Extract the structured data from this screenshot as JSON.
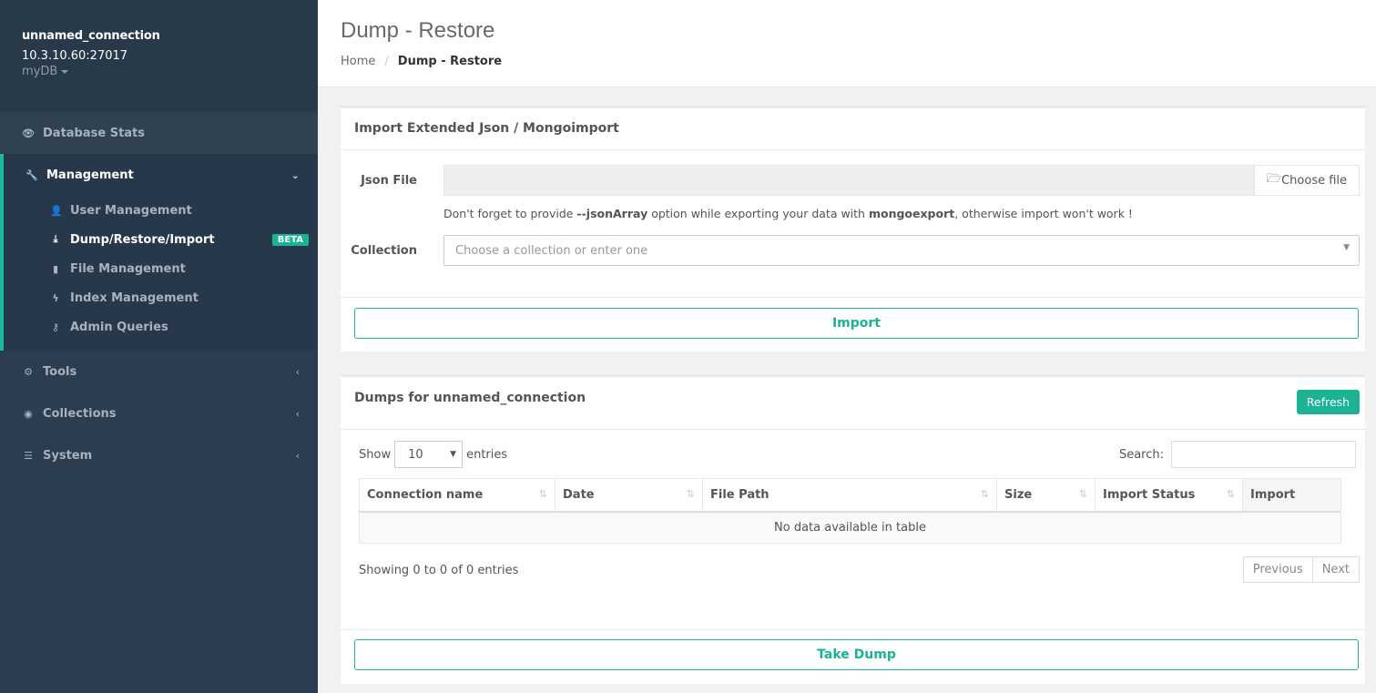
{
  "sidebar": {
    "connection": "unnamed_connection",
    "host": "10.3.10.60:27017",
    "database": "myDB",
    "items": {
      "stats": "Database Stats",
      "management": "Management",
      "tools": "Tools",
      "collections": "Collections",
      "system": "System"
    },
    "management_items": [
      "User Management",
      "Dump/Restore/Import",
      "File Management",
      "Index Management",
      "Admin Queries"
    ],
    "beta": "BETA"
  },
  "header": {
    "title": "Dump - Restore",
    "breadcrumb": [
      "Home",
      "Dump - Restore"
    ]
  },
  "import_box": {
    "title": "Import Extended Json / Mongoimport",
    "json_label": "Json File",
    "choose_file": "Choose file",
    "hint": {
      "pre": "Don't forget to provide ",
      "opt": "--jsonArray",
      "mid": " option while exporting your data with ",
      "tool": "mongoexport",
      "post": ", otherwise import won't work !"
    },
    "collection_label": "Collection",
    "collection_placeholder": "Choose a collection or enter one",
    "import_button": "Import"
  },
  "dumps_box": {
    "title": "Dumps for unnamed_connection",
    "refresh": "Refresh",
    "show": "Show",
    "entries_value": "10",
    "entries": "entries",
    "search": "Search:",
    "columns": [
      "Connection name",
      "Date",
      "File Path",
      "Size",
      "Import Status",
      "Import"
    ],
    "empty": "No data available in table",
    "info": "Showing 0 to 0 of 0 entries",
    "previous": "Previous",
    "next": "Next",
    "take_dump": "Take Dump"
  },
  "colors": {
    "accent": "#1ab394",
    "sidebar": "#2b3d4f"
  }
}
